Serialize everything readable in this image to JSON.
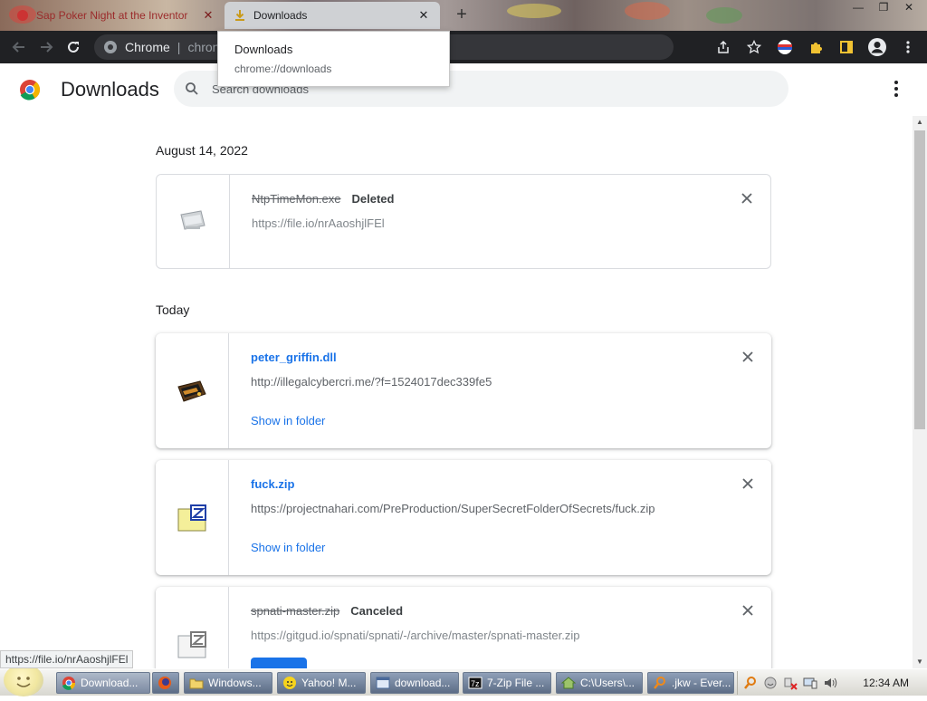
{
  "browser": {
    "tabs": [
      {
        "title": "Sap Poker Night at the Inventor",
        "active": false,
        "close_glyph": "✕"
      },
      {
        "title": "Downloads",
        "active": true,
        "close_glyph": "✕"
      }
    ],
    "new_tab_glyph": "+",
    "window_controls": {
      "minimize": "—",
      "restore": "❐",
      "close": "✕"
    },
    "omnibox": {
      "chip_label": "Chrome",
      "separator": "|",
      "url_partial": "chron"
    },
    "hover_card": {
      "title": "Downloads",
      "url": "chrome://downloads"
    }
  },
  "page": {
    "title": "Downloads",
    "search_placeholder": "Search downloads",
    "groups": [
      {
        "date": "August 14, 2022",
        "items": [
          {
            "name": "NtpTimeMon.exe",
            "status": "Deleted",
            "url": "https://file.io/nrAaoshjlFEl",
            "state": "deleted",
            "icon": "generic-file-icon"
          }
        ]
      },
      {
        "date": "Today",
        "items": [
          {
            "name": "peter_griffin.dll",
            "status": "",
            "url": "http://illegalcybercri.me/?f=1524017dec339fe5",
            "state": "complete",
            "action": "Show in folder",
            "icon": "dll-file-icon"
          },
          {
            "name": "fuck.zip",
            "status": "",
            "url": "https://projectnahari.com/PreProduction/SuperSecretFolderOfSecrets/fuck.zip",
            "state": "complete",
            "action": "Show in folder",
            "icon": "zip-file-icon"
          },
          {
            "name": "spnati-master.zip",
            "status": "Canceled",
            "url": "https://gitgud.io/spnati/spnati/-/archive/master/spnati-master.zip",
            "state": "canceled",
            "icon": "zip-file-faded-icon"
          }
        ]
      }
    ]
  },
  "status_bubble": "https://file.io/nrAaoshjlFEl",
  "taskbar": {
    "buttons": [
      {
        "label": "Download...",
        "icon": "chrome-icon",
        "active": true
      },
      {
        "label": "",
        "icon": "firefox-icon",
        "active": false
      },
      {
        "label": "Windows...",
        "icon": "folder-icon",
        "active": false
      },
      {
        "label": "Yahoo! M...",
        "icon": "yahoo-messenger-icon",
        "active": false
      },
      {
        "label": "download...",
        "icon": "explorer-window-icon",
        "active": false
      },
      {
        "label": "7-Zip File ...",
        "icon": "7zip-icon",
        "active": false
      },
      {
        "label": "C:\\Users\\...",
        "icon": "home-folder-icon",
        "active": false
      },
      {
        "label": ".jkw - Ever...",
        "icon": "everything-search-icon",
        "active": false
      }
    ],
    "clock": "12:34 AM"
  },
  "colors": {
    "link_blue": "#1a73e8",
    "toolbar_dark": "#202124",
    "taskbar_blue": "#5d6d86"
  }
}
